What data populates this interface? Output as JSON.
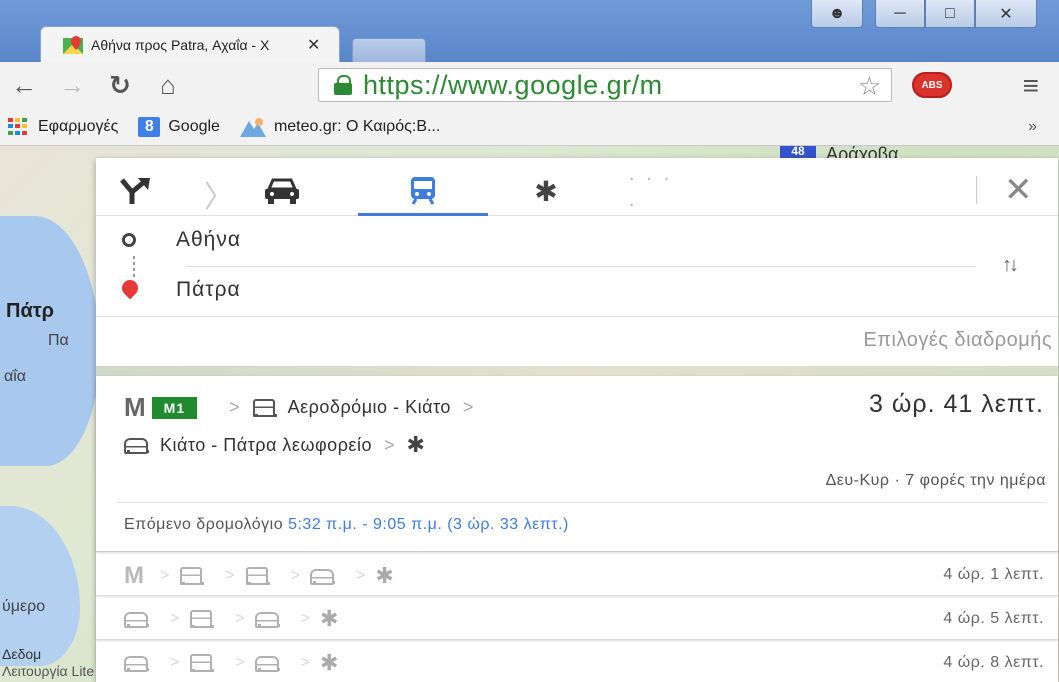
{
  "browser": {
    "tab_title": "Αθήνα προς Patra, Αχαΐα - Χ",
    "url_secure": "https://",
    "url_host": "www.google.gr/m",
    "bookmarks": [
      {
        "label": "Εφαρμογές",
        "icon": "apps-grid-icon"
      },
      {
        "label": "Google",
        "icon": "google-icon"
      },
      {
        "label": "meteo.gr: Ο Καιρός:Β...",
        "icon": "meteo-icon"
      }
    ],
    "bookmarks_more": "»",
    "abp_label": "ABS"
  },
  "map": {
    "road_badge": "48",
    "labels": {
      "araxova": "Αράχοβα",
      "patra": "Πάτρ",
      "pa": "Πα",
      "aia": "αΐα",
      "ymero": "ύμερο",
      "footer1": "Δεδομ",
      "footer2": "Λειτουργία Lite   Όροι   Απόρρητο"
    }
  },
  "directions": {
    "modes": [
      "best-route",
      "driving",
      "transit",
      "walking",
      "more"
    ],
    "active_mode": "transit",
    "more_label": "· · · ·",
    "origin": "Αθήνα",
    "destination": "Πάτρα",
    "route_options": "Επιλογές διαδρομής",
    "main_route": {
      "metro_letter": "M",
      "line": "M1",
      "segment1": "Αεροδρόμιο - Κιάτο",
      "segment2": "Κιάτο - Πάτρα λεωφορείο",
      "duration": "3 ώρ. 41 λεπτ.",
      "schedule": "Δευ-Κυρ · 7 φορές την ημέρα",
      "next_label": "Επόμενο δρομολόγιο ",
      "next_time": "5:32 π.μ. - 9:05 π.μ. (3 ώρ. 33 λεπτ.)"
    },
    "alt_routes": [
      {
        "duration": "4 ώρ. 1 λεπτ."
      },
      {
        "duration": "4 ώρ. 5 λεπτ."
      },
      {
        "duration": "4 ώρ. 8 λεπτ."
      }
    ]
  }
}
